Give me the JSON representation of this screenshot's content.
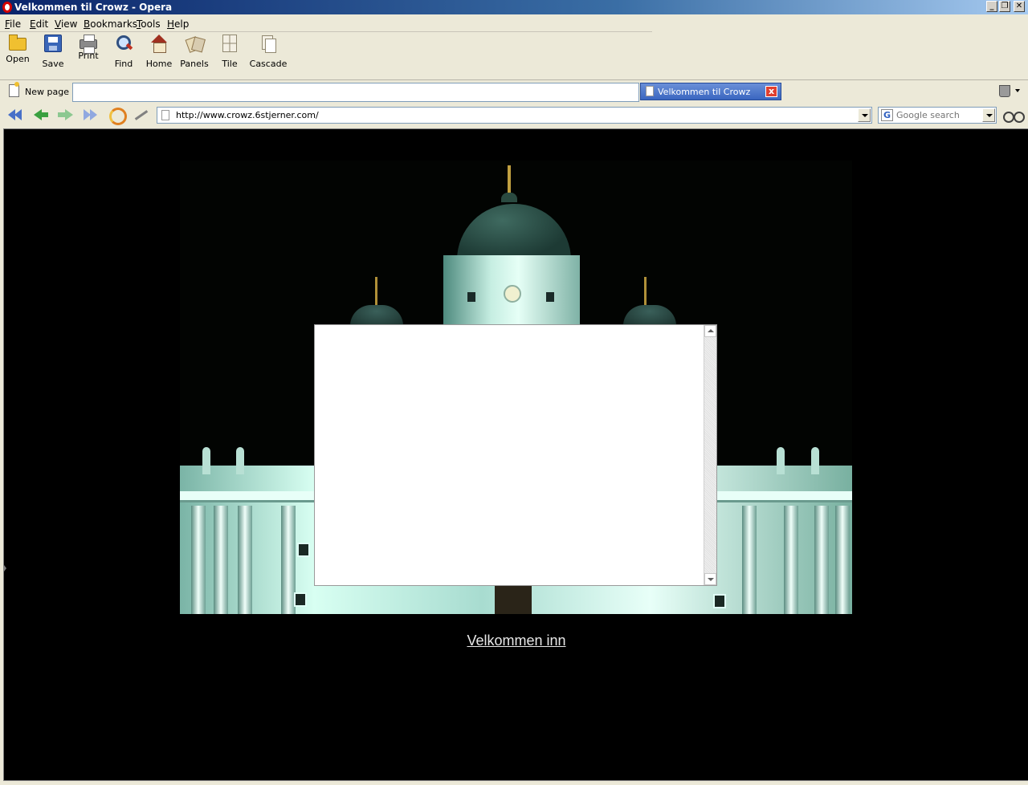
{
  "window": {
    "title": "Velkommen til Crowz - Opera",
    "buttons": {
      "minimize": "_",
      "restore": "❐",
      "close": "✕"
    }
  },
  "menu": {
    "items": [
      {
        "label": "File",
        "accel": "F",
        "rest": "ile"
      },
      {
        "label": "Edit",
        "accel": "E",
        "rest": "dit"
      },
      {
        "label": "View",
        "accel": "V",
        "rest": "iew"
      },
      {
        "label": "Bookmarks",
        "accel": "B",
        "rest": "ookmarks"
      },
      {
        "label": "Tools",
        "accel": "T",
        "rest": "ools"
      },
      {
        "label": "Help",
        "accel": "H",
        "rest": "elp"
      }
    ]
  },
  "toolbar": {
    "open": "Open",
    "save": "Save",
    "print": "Print",
    "find": "Find",
    "home": "Home",
    "panels": "Panels",
    "tile": "Tile",
    "cascade": "Cascade"
  },
  "tabs": {
    "new_page": "New page",
    "active_tab": "Velkommen til Crowz",
    "close_glyph": "x"
  },
  "address": {
    "url": "http://www.crowz.6stjerner.com/"
  },
  "search": {
    "engine_glyph": "G",
    "placeholder": "Google search"
  },
  "page": {
    "link_text": "Velkommen inn"
  },
  "colors": {
    "page_background": "#000000",
    "link": "#e8e8e8",
    "tab_active": "#3a66c0",
    "titlebar": "#0a246a"
  },
  "icons": {
    "open": "folder-icon",
    "save": "floppy-disk-icon",
    "print": "printer-icon",
    "find": "magnifier-icon",
    "home": "house-icon",
    "panels": "panels-icon",
    "tile": "tile-windows-icon",
    "cascade": "cascade-windows-icon",
    "rewind": "rewind-icon",
    "back": "back-arrow-icon",
    "forward": "forward-arrow-icon",
    "fast_forward": "fast-forward-icon",
    "reload": "reload-icon",
    "wand": "wand-icon",
    "trash": "trash-icon",
    "search_options": "glasses-icon"
  }
}
